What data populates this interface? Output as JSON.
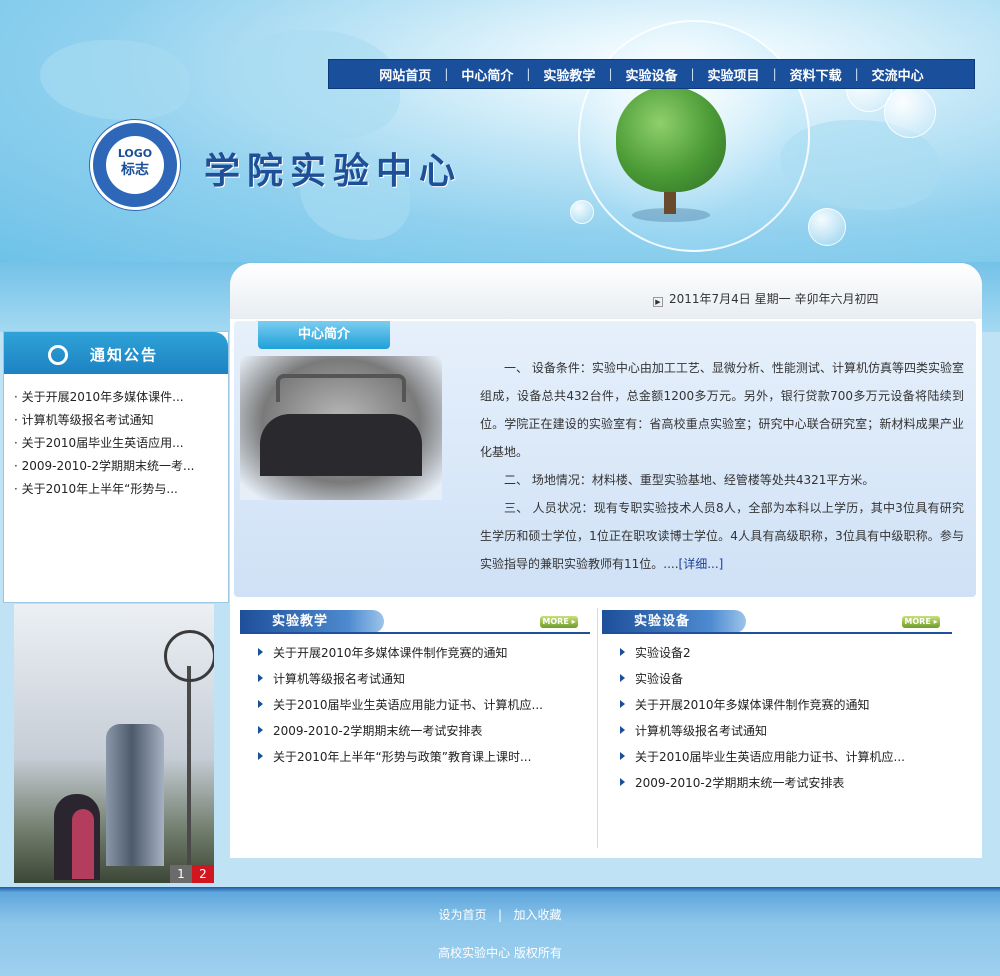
{
  "nav": [
    "网站首页",
    "中心简介",
    "实验教学",
    "实验设备",
    "实验项目",
    "资料下载",
    "交流中心"
  ],
  "nav_sep": "|",
  "logo": {
    "top": "LOGO",
    "bottom": "标志"
  },
  "site_title": "学院实验中心",
  "date_line": "2011年7月4日    星期一    辛卯年六月初四",
  "notice": {
    "title": "通知公告",
    "items": [
      "关于开展2010年多媒体课件...",
      "计算机等级报名考试通知",
      "关于2010届毕业生英语应用...",
      "2009-2010-2学期期末统一考...",
      "关于2010年上半年“形势与..."
    ]
  },
  "slider": {
    "pages": [
      "1",
      "2"
    ]
  },
  "intro": {
    "tab": "中心简介",
    "p1": "一、 设备条件：实验中心由加工工艺、显微分析、性能测试、计算机仿真等四类实验室组成，设备总共432台件，总金额1200多万元。另外，银行贷款700多万元设备将陆续到位。学院正在建设的实验室有：省高校重点实验室；研究中心联合研究室；新材料成果产业化基地。",
    "p2": "二、 场地情况：材料楼、重型实验基地、经管楼等处共4321平方米。",
    "p3": "三、 人员状况：现有专职实验技术人员8人，全部为本科以上学历，其中3位具有研究生学历和硕士学位，1位正在职攻读博士学位。4人具有高级职称，3位具有中级职称。参与实验指导的兼职实验教师有11位。....",
    "more": "[详细...]"
  },
  "teaching": {
    "title": "实验教学",
    "more": "MORE ▸",
    "items": [
      "关于开展2010年多媒体课件制作竞赛的通知",
      "计算机等级报名考试通知",
      "关于2010届毕业生英语应用能力证书、计算机应...",
      "2009-2010-2学期期末统一考试安排表",
      "关于2010年上半年“形势与政策”教育课上课时..."
    ]
  },
  "equipment": {
    "title": "实验设备",
    "more": "MORE ▸",
    "items": [
      "实验设备2",
      "实验设备",
      "关于开展2010年多媒体课件制作竞赛的通知",
      "计算机等级报名考试通知",
      "关于2010届毕业生英语应用能力证书、计算机应...",
      "2009-2010-2学期期末统一考试安排表"
    ]
  },
  "footer": {
    "home": "设为首页",
    "sep": "|",
    "fav": "加入收藏",
    "copyright": "高校实验中心  版权所有"
  },
  "colors": {
    "nav_bg": "#1a4f9c",
    "accent": "#1fa0d8",
    "pager_active": "#d2161f"
  }
}
